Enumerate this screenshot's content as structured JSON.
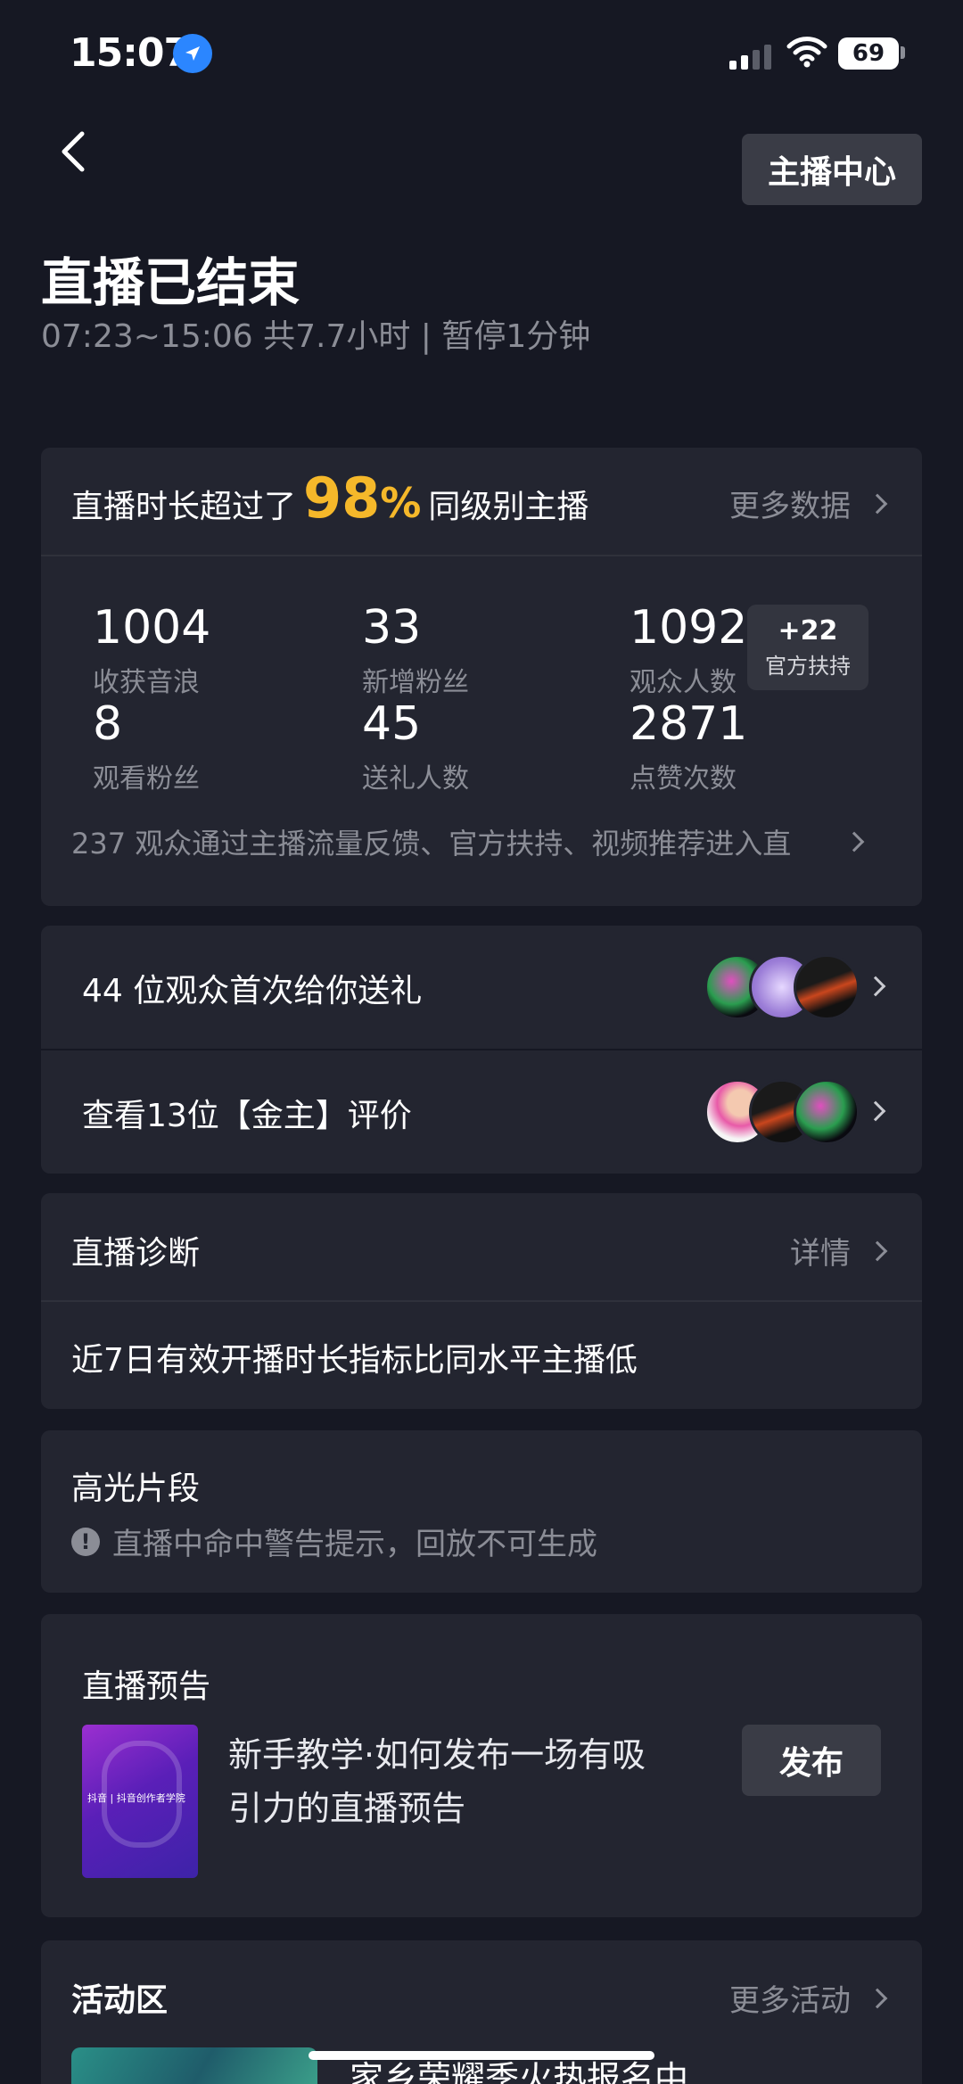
{
  "status_bar": {
    "time": "15:07",
    "battery": "69"
  },
  "header": {
    "back_icon": "chevron-left-icon",
    "center_button": "主播中心"
  },
  "live_summary": {
    "title": "直播已结束",
    "subtitle": "07:23~15:06 共7.7小时 | 暂停1分钟"
  },
  "rank_card": {
    "prefix": "直播时长超过了",
    "percent": "98",
    "percent_sign": "%",
    "suffix": "同级别主播",
    "more_link": "更多数据",
    "stats": [
      {
        "value": "1004",
        "label": "收获音浪"
      },
      {
        "value": "33",
        "label": "新增粉丝"
      },
      {
        "value": "1092",
        "label": "观众人数"
      },
      {
        "value": "8",
        "label": "观看粉丝"
      },
      {
        "value": "45",
        "label": "送礼人数"
      },
      {
        "value": "2871",
        "label": "点赞次数"
      }
    ],
    "support_badge": {
      "count": "+22",
      "label": "官方扶持"
    },
    "footer_text": "237 观众通过主播流量反馈、官方扶持、视频推荐进入直"
  },
  "gift_row": {
    "text": "44 位观众首次给你送礼"
  },
  "patron_row": {
    "text": "查看13位【金主】评价"
  },
  "diagnosis": {
    "title": "直播诊断",
    "link": "详情",
    "content": "近7日有效开播时长指标比同水平主播低"
  },
  "highlights": {
    "title": "高光片段",
    "warning": "直播中命中警告提示，回放不可生成"
  },
  "preview": {
    "title": "直播预告",
    "thumb_caption": "抖音 | 抖音创作者学院",
    "desc_line1": "新手教学·如何发布一场有吸",
    "desc_line2": "引力的直播预告",
    "publish_button": "发布"
  },
  "activity": {
    "title": "活动区",
    "link": "更多活动",
    "item_text": "家乡荣耀季火热报名中"
  },
  "colors": {
    "accent": "#f5b82a",
    "background": "#161823",
    "card": "#232530"
  }
}
